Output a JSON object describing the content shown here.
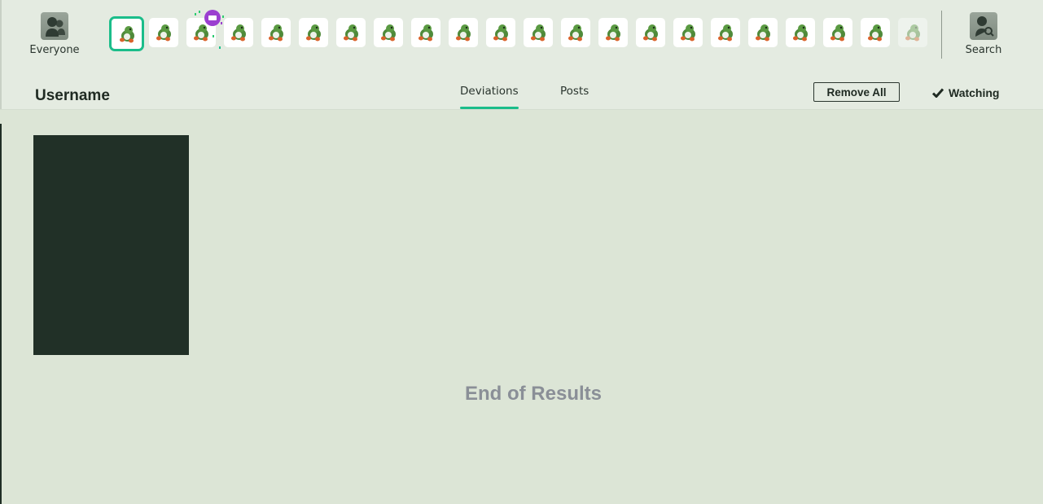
{
  "watch_bar": {
    "everyone_label": "Everyone",
    "search_label": "Search",
    "users": [
      {
        "name": "user-1",
        "selected": true,
        "faded": false
      },
      {
        "name": "user-2",
        "selected": false,
        "faded": false
      },
      {
        "name": "user-3",
        "selected": false,
        "faded": false,
        "birthday": true
      },
      {
        "name": "user-4",
        "selected": false,
        "faded": false
      },
      {
        "name": "user-5",
        "selected": false,
        "faded": false
      },
      {
        "name": "user-6",
        "selected": false,
        "faded": false
      },
      {
        "name": "user-7",
        "selected": false,
        "faded": false
      },
      {
        "name": "user-8",
        "selected": false,
        "faded": false
      },
      {
        "name": "user-9",
        "selected": false,
        "faded": false
      },
      {
        "name": "user-10",
        "selected": false,
        "faded": false
      },
      {
        "name": "user-11",
        "selected": false,
        "faded": false
      },
      {
        "name": "user-12",
        "selected": false,
        "faded": false
      },
      {
        "name": "user-13",
        "selected": false,
        "faded": false
      },
      {
        "name": "user-14",
        "selected": false,
        "faded": false
      },
      {
        "name": "user-15",
        "selected": false,
        "faded": false
      },
      {
        "name": "user-16",
        "selected": false,
        "faded": false
      },
      {
        "name": "user-17",
        "selected": false,
        "faded": false
      },
      {
        "name": "user-18",
        "selected": false,
        "faded": false
      },
      {
        "name": "user-19",
        "selected": false,
        "faded": false
      },
      {
        "name": "user-20",
        "selected": false,
        "faded": false
      },
      {
        "name": "user-21",
        "selected": false,
        "faded": false
      },
      {
        "name": "user-22",
        "selected": false,
        "faded": true
      }
    ]
  },
  "profile": {
    "username": "Username",
    "tabs": [
      {
        "label": "Deviations",
        "active": true
      },
      {
        "label": "Posts",
        "active": false
      }
    ],
    "remove_all_label": "Remove All",
    "watching_label": "Watching"
  },
  "results": {
    "end_label": "End of Results"
  },
  "colors": {
    "accent": "#1bbd8a",
    "background": "#dce5d6",
    "header_bg": "#e4ebe1",
    "card": "#213027",
    "end_text": "#8a8f97"
  }
}
